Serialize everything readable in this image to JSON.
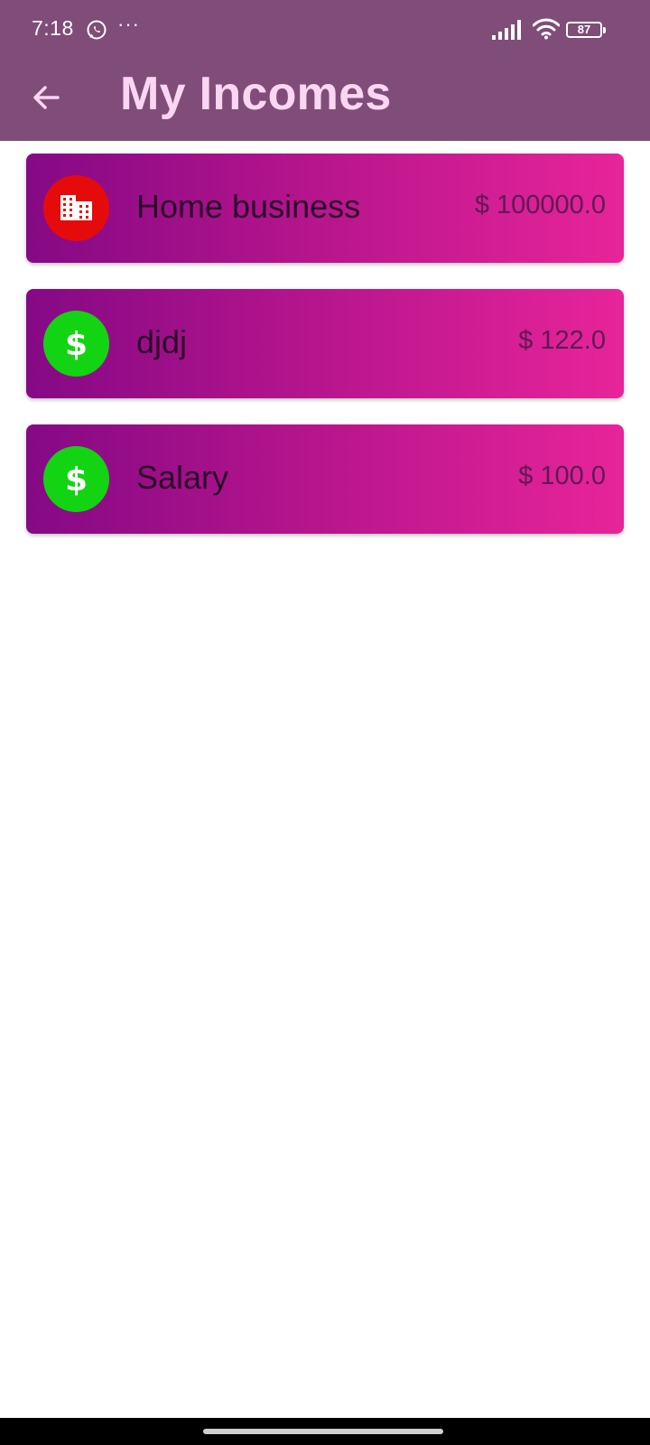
{
  "status_bar": {
    "time": "7:18",
    "more_indicator": "···",
    "battery_level": "87",
    "icons": [
      "whatsapp-icon",
      "signal-icon",
      "wifi-icon",
      "battery-icon"
    ]
  },
  "app_bar": {
    "title": "My Incomes",
    "back_icon": "arrow-left-icon"
  },
  "incomes": [
    {
      "name": "Home business",
      "amount": "$ 100000.0",
      "icon": "building-icon",
      "icon_color": "#e60b0b"
    },
    {
      "name": "djdj",
      "amount": "$ 122.0",
      "icon": "dollar-icon",
      "icon_color": "#12d412"
    },
    {
      "name": "Salary",
      "amount": "$ 100.0",
      "icon": "dollar-icon",
      "icon_color": "#12d412"
    }
  ],
  "colors": {
    "app_bar": "#7f4d78",
    "title": "#fbd6f2",
    "card_gradient_start": "#850985",
    "card_gradient_end": "#e8249a"
  }
}
